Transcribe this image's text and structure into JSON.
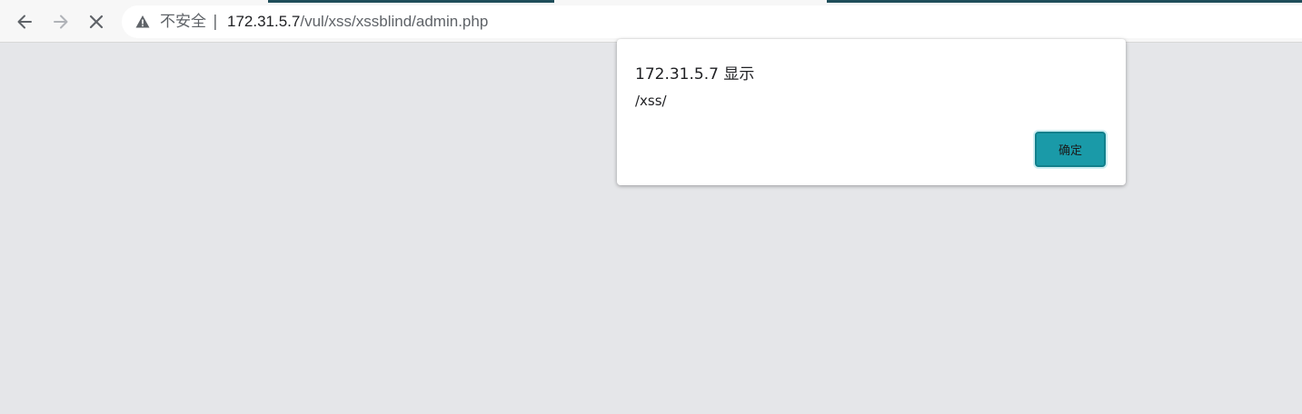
{
  "browser": {
    "nav": {
      "back_icon": "arrow-left-icon",
      "forward_icon": "arrow-right-icon",
      "stop_icon": "close-icon"
    },
    "address_bar": {
      "security_icon": "warning-triangle-icon",
      "security_label": "不安全",
      "separator": "|",
      "url_host": "172.31.5.7",
      "url_path": "/vul/xss/xssblind/admin.php"
    }
  },
  "alert_dialog": {
    "title": "172.31.5.7 显示",
    "message": "/xss/",
    "ok_label": "确定",
    "accent_color": "#1a9aa8"
  },
  "page": {
    "background_color": "#e5e6e9"
  }
}
